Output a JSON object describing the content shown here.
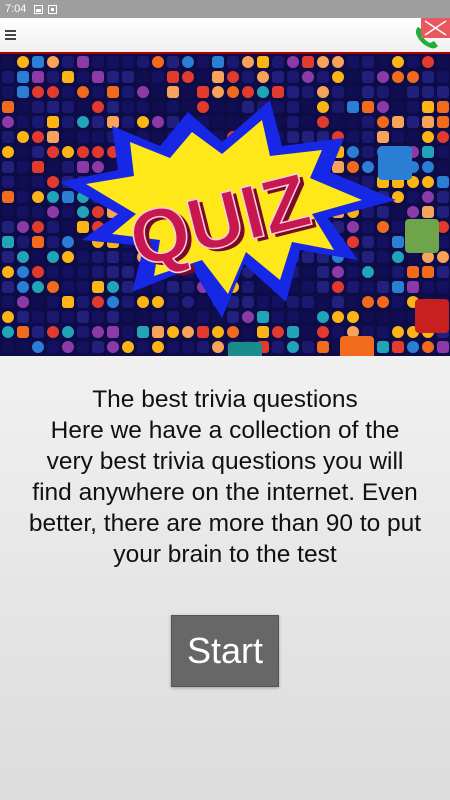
{
  "status_bar": {
    "time": "7:04",
    "icons": [
      "image-icon",
      "notification-box-icon"
    ]
  },
  "app_bar": {
    "menu_icon": "hamburger-menu-icon",
    "right_icon": "phone-icon",
    "close_icon": "close-icon"
  },
  "banner": {
    "title": "QUIZ"
  },
  "description": {
    "lines": [
      "The best trivia questions",
      "Here we have a collection of the",
      "very best trivia questions you will",
      "find anywhere on the internet. Even",
      "better, there are more than 90 to put",
      "your brain to the test"
    ]
  },
  "start_button": {
    "label": "Start"
  },
  "colors": {
    "accent_red": "#b50000",
    "button_gray": "#676767",
    "quiz_text": "#c8174f",
    "starburst_yellow": "#ffe81a",
    "starburst_blue": "#1727e6"
  }
}
